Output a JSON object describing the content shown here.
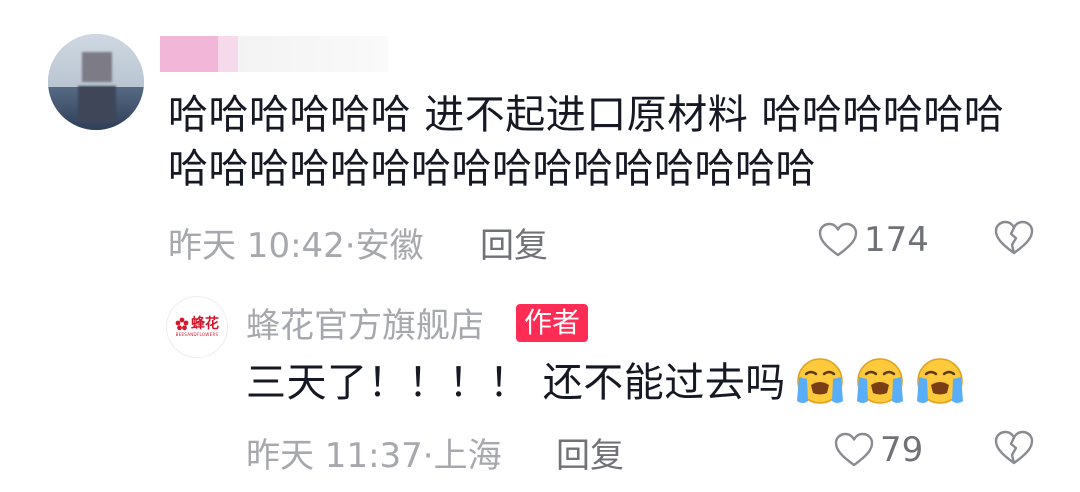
{
  "comments": [
    {
      "text_line1": "哈哈哈哈哈哈 进不起进口原材料 哈哈哈哈哈哈",
      "text_line2": "哈哈哈哈哈哈哈哈哈哈哈哈哈哈哈哈",
      "time": "昨天 10:42·",
      "location": "安徽",
      "reply_label": "回复",
      "likes": "174"
    }
  ],
  "reply": {
    "username": "蜂花官方旗舰店",
    "badge": "作者",
    "avatar_logo_text": "蜂花",
    "avatar_logo_sub": "BEESANDFLOWERS",
    "text": "三天了！！！！ 还不能过去吗",
    "emojis": [
      "loudly-crying-face",
      "loudly-crying-face",
      "loudly-crying-face"
    ],
    "time": "昨天 11:37·",
    "location": "上海",
    "reply_label": "回复",
    "likes": "79"
  },
  "colors": {
    "text": "#161823",
    "meta": "#a7a8ad",
    "action": "#707278",
    "badge": "#ff2c55",
    "brand": "#d3162b",
    "emoji": "#ffc93c",
    "tear": "#5aaef7"
  }
}
